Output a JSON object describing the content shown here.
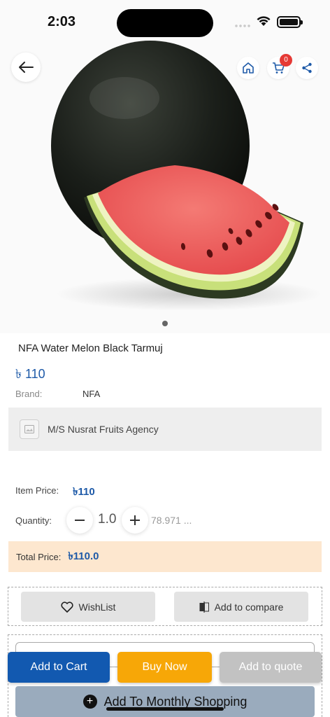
{
  "status_bar": {
    "time": "2:03"
  },
  "header": {
    "cart_count": "0"
  },
  "product": {
    "name": "NFA Water Melon Black Tarmuj",
    "price": "৳ 110",
    "brand_label": "Brand:",
    "brand_value": "NFA",
    "vendor_name": "M/S Nusrat Fruits Agency"
  },
  "pricing": {
    "item_price_label": "Item Price:",
    "item_price_value": "৳110",
    "quantity_label": "Quantity:",
    "quantity_value": "1.0",
    "quantity_approx": "78.971 ...",
    "total_label": "Total Price:",
    "total_value": "৳110.0"
  },
  "actions": {
    "wishlist_label": "WishList",
    "compare_label": "Add to compare",
    "add_to_cart_label": "Add to Cart",
    "buy_now_label": "Buy Now",
    "add_to_quote_label": "Add to quote",
    "monthly_label": "Add To Monthly Shopping"
  },
  "colors": {
    "add_to_cart": "#1259b0",
    "buy_now": "#f7a707",
    "add_to_quote": "#c2c2c2",
    "price_blue": "#1e5aa8",
    "total_bg": "#fde7cf"
  },
  "icons": {
    "back": "back-arrow-icon",
    "home": "home-icon",
    "cart": "cart-icon",
    "share": "share-icon",
    "heart": "heart-icon",
    "compare": "compare-icon",
    "plus": "plus-circle-icon"
  }
}
